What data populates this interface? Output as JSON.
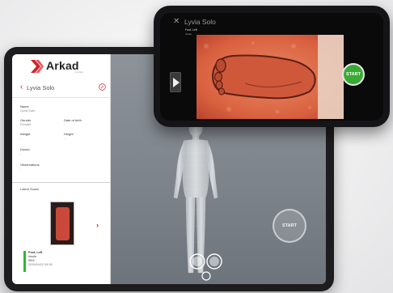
{
  "brand": {
    "name": "Arkad",
    "tagline": "by Arkad",
    "accent_color": "#c8242c"
  },
  "tablet": {
    "patient_header": {
      "back_icon": "chevron-left-icon",
      "name": "Lyvia Solo",
      "edit_icon": "edit-icon"
    },
    "fields": {
      "name_label": "Name",
      "name_value": "Lyvia Solo",
      "gender_label": "Gender",
      "gender_value": "Female",
      "dob_label": "Date of birth",
      "dob_value": "-",
      "weight_label": "Weight",
      "weight_value": "-",
      "height_label": "Height",
      "height_value": "-",
      "doctor_label": "Doctor",
      "doctor_value": "-",
      "observations_label": "Observations",
      "observations_value": "-"
    },
    "latest_scans": {
      "title": "Latest Scans",
      "next_icon": "chevron-right-icon",
      "card": {
        "side": "Foot, Left",
        "type": "Insole",
        "percent": "95%",
        "date": "2019/04/12 09:36"
      }
    },
    "start_label": "START"
  },
  "phone": {
    "close_icon": "close-icon",
    "title": "Lyvia Solo",
    "subtitle": "Foot, Left",
    "status": "Insole",
    "start_label": "START",
    "start_color": "#3aaa35",
    "expand_icon": "play-arrow-icon"
  }
}
